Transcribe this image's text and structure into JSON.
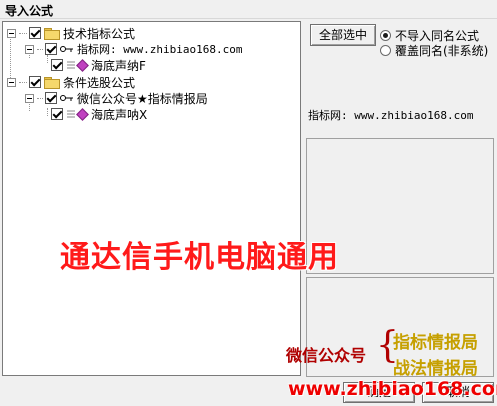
{
  "window": {
    "title": "导入公式"
  },
  "tree": {
    "groups": [
      {
        "label": "技术指标公式",
        "item_label": "指标网: www.zhibiao168.com",
        "formula_label": "海底声纳F"
      },
      {
        "label": "条件选股公式",
        "item_label": "微信公众号★指标情报局",
        "formula_label": "海底声呐X"
      }
    ]
  },
  "actions": {
    "select_all_label": "全部选中",
    "confirm_label": "确定",
    "cancel_label": "取消"
  },
  "options": {
    "skip_same_name_label": "不导入同名公式",
    "overwrite_same_name_label": "覆盖同名(非系统)",
    "selected": "skip_same_name"
  },
  "info": {
    "description_text": "指标网: www.zhibiao168.com"
  },
  "overlay": {
    "banner": "通达信手机电脑通用",
    "wechat_label": "微信公众号",
    "brace": "{",
    "channel_line1": "指标情报局",
    "channel_line2": "战法情报局",
    "url": "www.zhibiao168.com"
  },
  "colors": {
    "banner": "#ff1a1a",
    "wechat": "#b00000",
    "channel": "#c6a000",
    "url": "#ee0000"
  }
}
